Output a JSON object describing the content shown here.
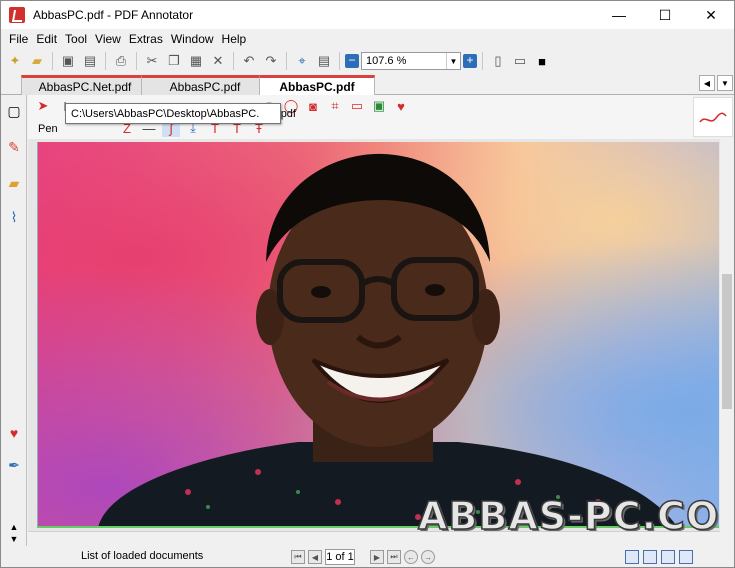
{
  "window": {
    "title": "AbbasPC.pdf - PDF Annotator",
    "minimize": "—",
    "maximize": "☐",
    "close": "✕"
  },
  "menu": [
    "File",
    "Edit",
    "Tool",
    "View",
    "Extras",
    "Window",
    "Help"
  ],
  "toolbar": {
    "zoom_value": "107.6 %",
    "zoom_out": "−",
    "zoom_in": "+"
  },
  "tabs": [
    {
      "label": "AbbasPC.Net.pdf",
      "active": false
    },
    {
      "label": "AbbasPC.pdf",
      "active": false
    },
    {
      "label": "AbbasPC.pdf",
      "active": true
    }
  ],
  "annotation": {
    "tool_label": "Pen",
    "tooltip": "C:\\Users\\AbbasPC\\Desktop\\AbbasPC.       pdf"
  },
  "document": {
    "watermark": "ABBAS-PC.COM"
  },
  "status": {
    "text": "List of loaded documents",
    "page_value": "1",
    "page_total": "of 1"
  },
  "colors": {
    "accent": "#d9413a",
    "pen": "#d52b2b"
  }
}
